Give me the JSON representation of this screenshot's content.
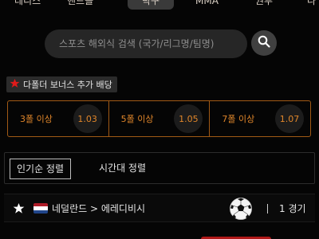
{
  "sports_tabs": [
    {
      "label": "테니스",
      "active": false
    },
    {
      "label": "핸드볼",
      "active": false
    },
    {
      "label": "탁구",
      "active": true
    },
    {
      "label": "MMA",
      "active": false
    },
    {
      "label": "권투",
      "active": false
    },
    {
      "label": "다",
      "active": false
    }
  ],
  "search": {
    "placeholder": "스포츠 해외식 검색 (국가/리그명/팀명)",
    "value": "",
    "icon": "search-icon"
  },
  "bonus": {
    "title": "다폴더 보너스 추가 배당",
    "icon": "star-icon",
    "icon_color": "#e01a1a",
    "accent_color": "#e0862a",
    "items": [
      {
        "label": "3폴 이상",
        "odds": "1.03"
      },
      {
        "label": "5폴 이상",
        "odds": "1.05"
      },
      {
        "label": "7폴 이상",
        "odds": "1.07"
      }
    ]
  },
  "sort": {
    "options": [
      "인기순 정렬",
      "시간대 정렬"
    ],
    "active_index": 0
  },
  "league": {
    "country": "네덜란드",
    "separator": ">",
    "name": "에레디비시",
    "display": "네덜란드 > 에레디비시",
    "sport_icon": "soccer-ball-icon",
    "count_number": "1",
    "count_label": "경기",
    "favorite_icon": "star-icon",
    "flag_colors": [
      "#ae1c28",
      "#ffffff",
      "#21468b"
    ]
  }
}
